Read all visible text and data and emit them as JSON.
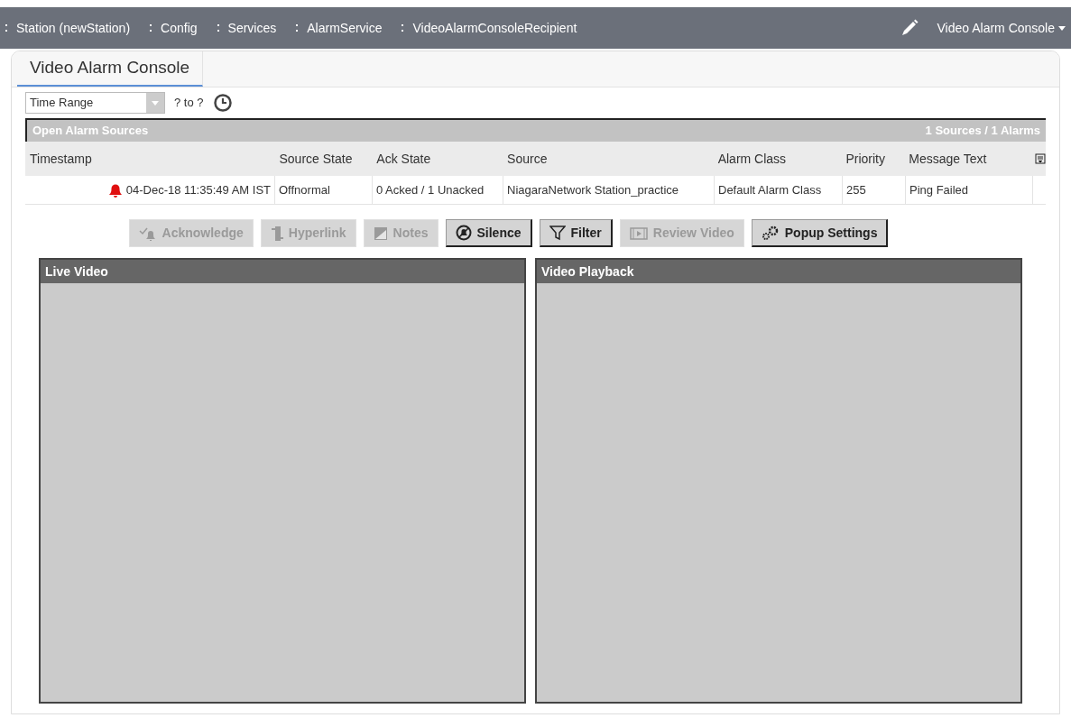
{
  "breadcrumb": [
    {
      "label": "Station (newStation)"
    },
    {
      "label": "Config"
    },
    {
      "label": "Services"
    },
    {
      "label": "AlarmService"
    },
    {
      "label": "VideoAlarmConsoleRecipient"
    }
  ],
  "view_selector": {
    "label": "Video Alarm Console"
  },
  "tab": {
    "label": "Video Alarm Console",
    "selected": true
  },
  "time_filter": {
    "value": "Time Range",
    "range": "? to ?"
  },
  "table": {
    "title": "Open Alarm Sources",
    "summary": "1 Sources / 1 Alarms",
    "columns": [
      "Timestamp",
      "Source State",
      "Ack State",
      "Source",
      "Alarm Class",
      "Priority",
      "Message Text"
    ],
    "rows": [
      {
        "cells": [
          "04-Dec-18 11:35:49 AM IST",
          "Offnormal",
          "0 Acked / 1 Unacked",
          "NiagaraNetwork Station_practice",
          "Default Alarm Class",
          "255",
          "Ping Failed"
        ],
        "alarm": true
      }
    ]
  },
  "buttons": [
    {
      "label": "Acknowledge",
      "disabled": true
    },
    {
      "label": "Hyperlink",
      "disabled": true
    },
    {
      "label": "Notes",
      "disabled": true
    },
    {
      "label": "Silence",
      "disabled": false
    },
    {
      "label": "Filter",
      "disabled": false
    },
    {
      "label": "Review Video",
      "disabled": true
    },
    {
      "label": "Popup Settings",
      "disabled": false
    }
  ],
  "panels": [
    {
      "title": "Live Video"
    },
    {
      "title": "Video Playback"
    }
  ]
}
